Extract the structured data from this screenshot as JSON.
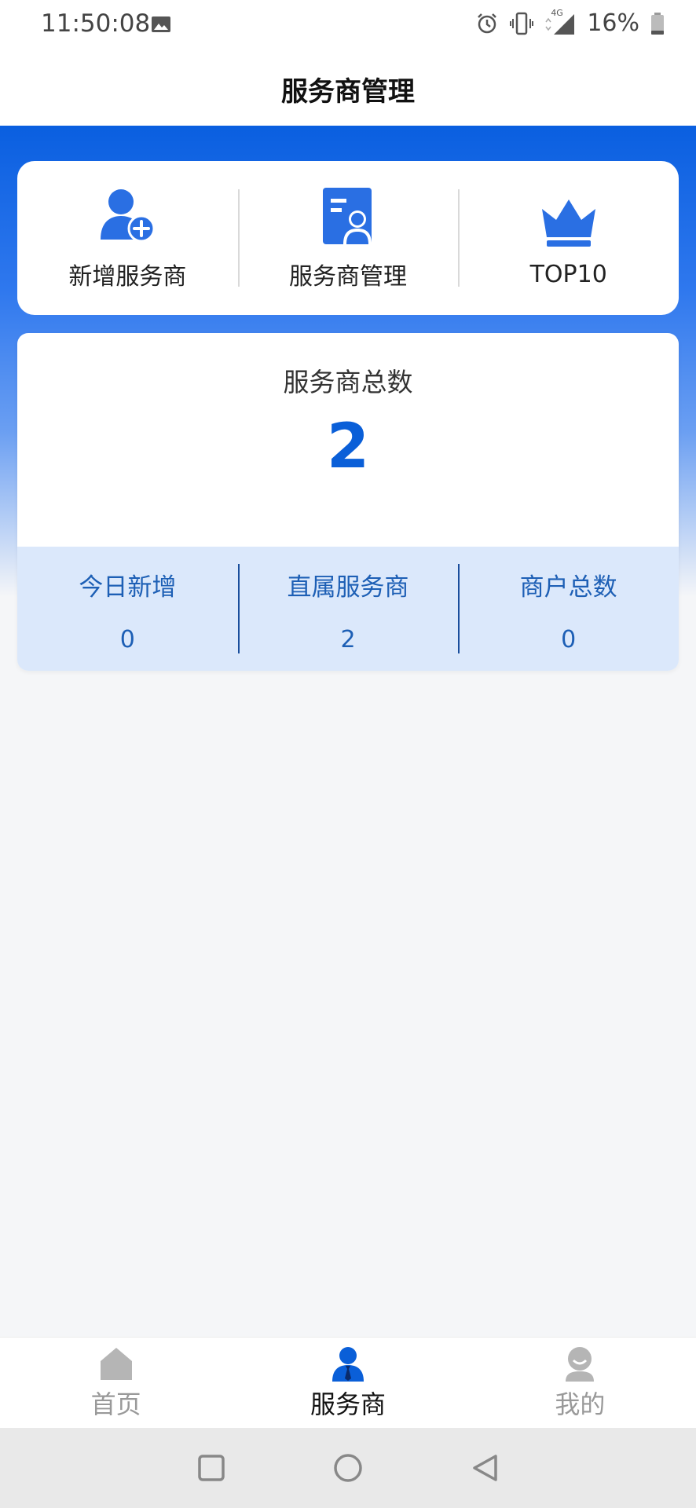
{
  "status_bar": {
    "time": "11:50:08",
    "network": "4G",
    "battery": "16%"
  },
  "header": {
    "title": "服务商管理"
  },
  "quick_actions": [
    {
      "label": "新增服务商",
      "icon": "add-user-icon"
    },
    {
      "label": "服务商管理",
      "icon": "user-profile-doc-icon"
    },
    {
      "label": "TOP10",
      "icon": "crown-icon"
    }
  ],
  "stats": {
    "title": "服务商总数",
    "total": "2",
    "items": [
      {
        "label": "今日新增",
        "value": "0"
      },
      {
        "label": "直属服务商",
        "value": "2"
      },
      {
        "label": "商户总数",
        "value": "0"
      }
    ]
  },
  "tabbar": {
    "items": [
      {
        "label": "首页",
        "icon": "home-icon",
        "active": false
      },
      {
        "label": "服务商",
        "icon": "agent-icon",
        "active": true
      },
      {
        "label": "我的",
        "icon": "profile-icon",
        "active": false
      }
    ]
  },
  "colors": {
    "accent": "#0a5fd8",
    "sub_bg": "#dbe8fb",
    "inactive": "#999999"
  }
}
